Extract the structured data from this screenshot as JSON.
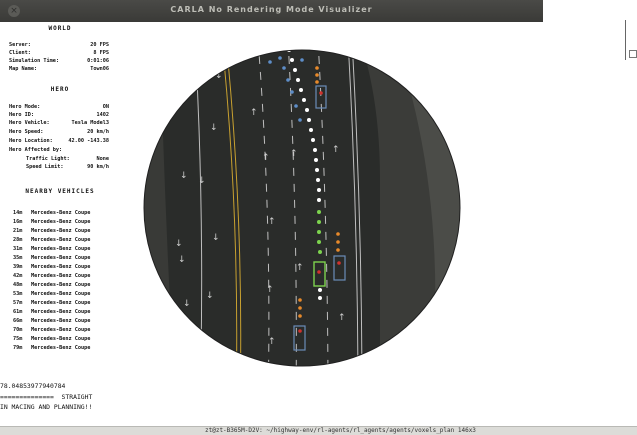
{
  "window": {
    "title": "CARLA No Rendering Mode Visualizer",
    "close_glyph": "×"
  },
  "hud": {
    "world": {
      "title": "WORLD",
      "rows": [
        {
          "key": "Server:",
          "value": "20 FPS"
        },
        {
          "key": "Client:",
          "value": "8 FPS"
        },
        {
          "key": "Simulation Time:",
          "value": "0:01:06"
        },
        {
          "key": "Map Name:",
          "value": "Town06"
        }
      ]
    },
    "hero": {
      "title": "HERO",
      "rows": [
        {
          "key": "Hero Mode:",
          "value": "ON"
        },
        {
          "key": "Hero ID:",
          "value": "1402"
        },
        {
          "key": "Hero Vehicle:",
          "value": "Tesla Model3"
        },
        {
          "key": "Hero Speed:",
          "value": "20 km/h"
        },
        {
          "key": "Hero Location:",
          "value": "42.00 -143.38"
        },
        {
          "key": "Hero Affected by:",
          "value": ""
        },
        {
          "key": "Traffic Light:",
          "value": "None"
        },
        {
          "key": "Speed Limit:",
          "value": "90 km/h"
        }
      ]
    },
    "nearby": {
      "title": "NEARBY VEHICLES",
      "vehicles": [
        {
          "dist": "14m",
          "name": "Mercedes-Benz Coupe"
        },
        {
          "dist": "16m",
          "name": "Mercedes-Benz Coupe"
        },
        {
          "dist": "21m",
          "name": "Mercedes-Benz Coupe"
        },
        {
          "dist": "28m",
          "name": "Mercedes-Benz Coupe"
        },
        {
          "dist": "31m",
          "name": "Mercedes-Benz Coupe"
        },
        {
          "dist": "35m",
          "name": "Mercedes-Benz Coupe"
        },
        {
          "dist": "39m",
          "name": "Mercedes-Benz Coupe"
        },
        {
          "dist": "42m",
          "name": "Mercedes-Benz Coupe"
        },
        {
          "dist": "48m",
          "name": "Mercedes-Benz Coupe"
        },
        {
          "dist": "53m",
          "name": "Mercedes-Benz Coupe"
        },
        {
          "dist": "57m",
          "name": "Mercedes-Benz Coupe"
        },
        {
          "dist": "61m",
          "name": "Mercedes-Benz Coupe"
        },
        {
          "dist": "66m",
          "name": "Mercedes-Benz Coupe"
        },
        {
          "dist": "70m",
          "name": "Mercedes-Benz Coupe"
        },
        {
          "dist": "75m",
          "name": "Mercedes-Benz Coupe"
        },
        {
          "dist": "79m",
          "name": "Mercedes-Benz Coupe"
        }
      ]
    }
  },
  "terminal": {
    "line1": "78.04853977940784",
    "line2": "==============  STRAIGHT",
    "line3": "IN MACING AND PLANNING!!"
  },
  "taskbar": {
    "text": "zt@zt-B365M-D2V: ~/highway-env/rl-agents/rl_agents/agents/voxels_plan 146x3"
  },
  "colors": {
    "road": "#2b2d2b",
    "grass": "#3e3f3c",
    "lane_marking": "#bfbfbf",
    "yellow_marking": "#c8a130",
    "hero": "#7dd34e",
    "planned_path": "#ffffff",
    "trajectory_dots": "#5e8ec8",
    "vehicle_outline": "#6b8cb8",
    "vehicle_orange": "#e88a2a"
  }
}
